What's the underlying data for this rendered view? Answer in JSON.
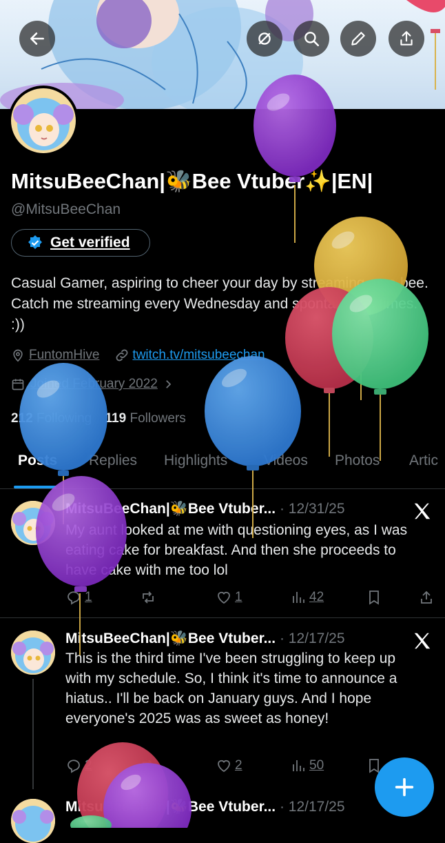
{
  "topbar": {
    "back_icon": "arrow-left-icon",
    "icons": [
      "sparkle-icon",
      "search-icon",
      "pencil-icon",
      "share-icon"
    ]
  },
  "profile": {
    "display_name": "MitsuBeeChan|🐝Bee Vtuber✨|EN|",
    "handle": "@MitsuBeeChan",
    "verify_label": "Get verified",
    "bio": "Casual Gamer, aspiring to cheer your day by streaming as a bee. Catch me streaming every Wednesday and spontaneous times. :))",
    "location": "FuntomHive",
    "website": "twitch.tv/mitsubeechan",
    "joined": "Joined February 2022",
    "following_count": "212",
    "following_label": "Following",
    "followers_count": "119",
    "followers_label": "Followers"
  },
  "tabs": [
    "Posts",
    "Replies",
    "Highlights",
    "Videos",
    "Photos",
    "Artic"
  ],
  "posts": [
    {
      "name": "MitsuBeeChan|🐝Bee Vtuber...",
      "date": "· 12/31/25",
      "text": "My aunt looked at me with questioning eyes, as I was eating cake for breakfast. And then she proceeds to have cake with me too lol",
      "replies": "1",
      "reposts": "",
      "likes": "1",
      "views": "42"
    },
    {
      "name": "MitsuBeeChan|🐝Bee Vtuber...",
      "date": "· 12/17/25",
      "text": "This is the third time I've been struggling to keep up with my schedule. So, I think it's time to announce a hiatus.. I'll be back on January guys. And I hope everyone's 2025 was as sweet as honey!",
      "replies": "2",
      "reposts": "",
      "likes": "2",
      "views": "50"
    },
    {
      "name": "MitsuBeeChan|🐝Bee Vtuber...",
      "date": "· 12/17/25"
    }
  ],
  "fab_icon": "plus-icon",
  "colors": {
    "accent": "#1d9bf0",
    "background": "#000000",
    "muted": "#71767b"
  }
}
